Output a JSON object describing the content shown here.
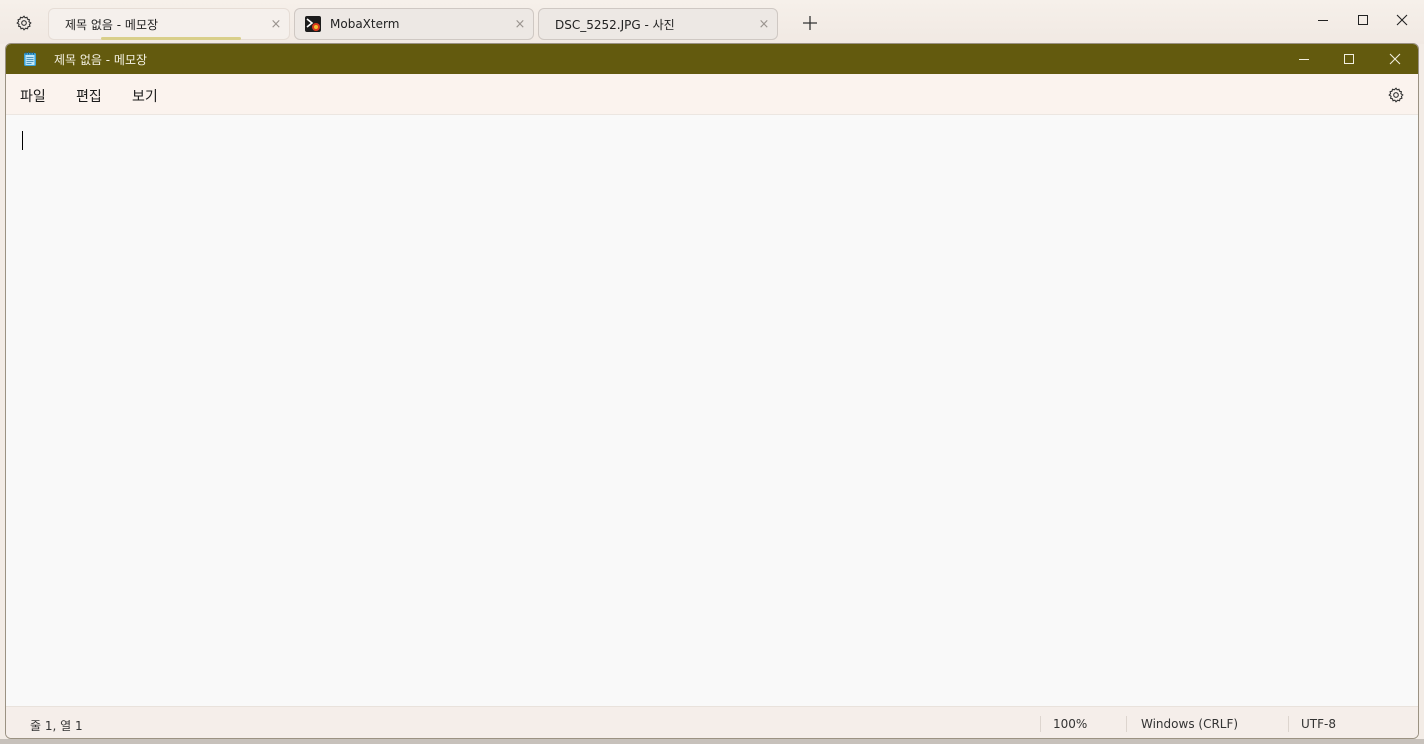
{
  "outer_tabbar": {
    "tabs": [
      {
        "label": "제목 없음 - 메모장",
        "active": true
      },
      {
        "label": "MobaXterm",
        "active": false
      },
      {
        "label": "DSC_5252.JPG - 사진",
        "active": false
      }
    ],
    "close_glyph": "×",
    "new_tab_icon": "plus-icon",
    "settings_icon": "gear-icon"
  },
  "notepad": {
    "title": "제목 없음 - 메모장",
    "title_bar_color": "#635a0e",
    "menu": {
      "file": "파일",
      "edit": "편집",
      "view": "보기"
    },
    "editor": {
      "content": ""
    },
    "status": {
      "position": "줄 1, 열 1",
      "zoom": "100%",
      "line_ending": "Windows (CRLF)",
      "encoding": "UTF-8"
    }
  }
}
